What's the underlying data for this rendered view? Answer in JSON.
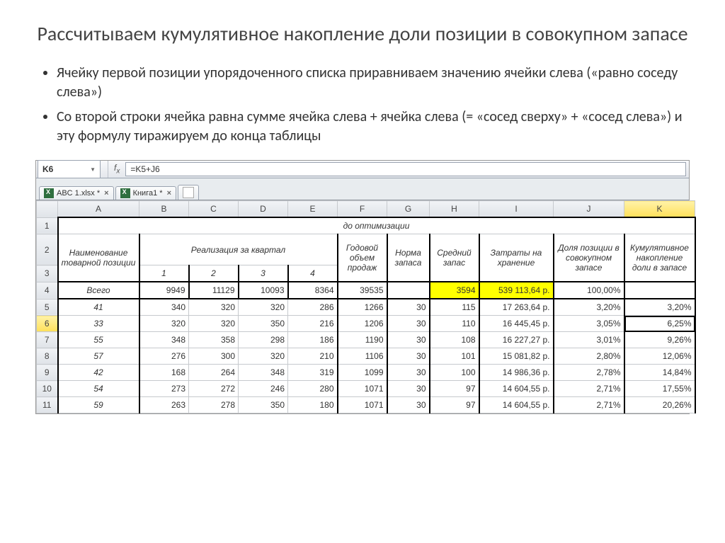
{
  "title": "Рассчитываем кумулятивное накопление доли позиции в совокупном запасе",
  "bullets": [
    "Ячейку первой позиции упорядоченного списка приравниваем значению ячейки слева («равно соседу слева»)",
    "Со второй строки ячейка равна сумме ячейка слева + ячейка слева (= «сосед сверху» + «сосед слева») и эту формулу тиражируем до конца таблицы"
  ],
  "namebox": "K6",
  "formula": "=K5+J6",
  "tabs": [
    "ABC 1.xlsx *",
    "Книга1 *"
  ],
  "cols": [
    "",
    "A",
    "B",
    "C",
    "D",
    "E",
    "F",
    "G",
    "H",
    "I",
    "J",
    "K"
  ],
  "rowlabels": [
    "1",
    "2",
    "3",
    "4",
    "5",
    "6",
    "7",
    "8",
    "9",
    "10",
    "11"
  ],
  "headers": {
    "r1": "до оптимизации",
    "nameCol": "Наименование товарной позиции",
    "real": "Реализация за квартал",
    "q": [
      "1",
      "2",
      "3",
      "4"
    ],
    "godov": "Годовой объем продаж",
    "norma": "Норма запаса",
    "sred": "Средний запас",
    "zatr": "Затраты на хранение",
    "dolya": "Доля позиции в совокупном запасе",
    "kumul": "Кумулятивное накопление доли в запасе"
  },
  "rows": [
    {
      "a": "Всего",
      "b": "9949",
      "c": "11129",
      "d": "10093",
      "e": "8364",
      "f": "39535",
      "g": "",
      "h": "3594",
      "i": "539 113,64 р.",
      "j": "100,00%",
      "k": ""
    },
    {
      "a": "41",
      "b": "340",
      "c": "320",
      "d": "320",
      "e": "286",
      "f": "1266",
      "g": "30",
      "h": "115",
      "i": "17 263,64 р.",
      "j": "3,20%",
      "k": "3,20%"
    },
    {
      "a": "33",
      "b": "320",
      "c": "320",
      "d": "350",
      "e": "216",
      "f": "1206",
      "g": "30",
      "h": "110",
      "i": "16 445,45 р.",
      "j": "3,05%",
      "k": "6,25%"
    },
    {
      "a": "55",
      "b": "348",
      "c": "358",
      "d": "298",
      "e": "186",
      "f": "1190",
      "g": "30",
      "h": "108",
      "i": "16 227,27 р.",
      "j": "3,01%",
      "k": "9,26%"
    },
    {
      "a": "57",
      "b": "276",
      "c": "300",
      "d": "320",
      "e": "210",
      "f": "1106",
      "g": "30",
      "h": "101",
      "i": "15 081,82 р.",
      "j": "2,80%",
      "k": "12,06%"
    },
    {
      "a": "42",
      "b": "168",
      "c": "264",
      "d": "348",
      "e": "319",
      "f": "1099",
      "g": "30",
      "h": "100",
      "i": "14 986,36 р.",
      "j": "2,78%",
      "k": "14,84%"
    },
    {
      "a": "54",
      "b": "273",
      "c": "272",
      "d": "246",
      "e": "280",
      "f": "1071",
      "g": "30",
      "h": "97",
      "i": "14 604,55 р.",
      "j": "2,71%",
      "k": "17,55%"
    },
    {
      "a": "59",
      "b": "263",
      "c": "278",
      "d": "350",
      "e": "180",
      "f": "1071",
      "g": "30",
      "h": "97",
      "i": "14 604,55 р.",
      "j": "2,71%",
      "k": "20,26%"
    }
  ]
}
